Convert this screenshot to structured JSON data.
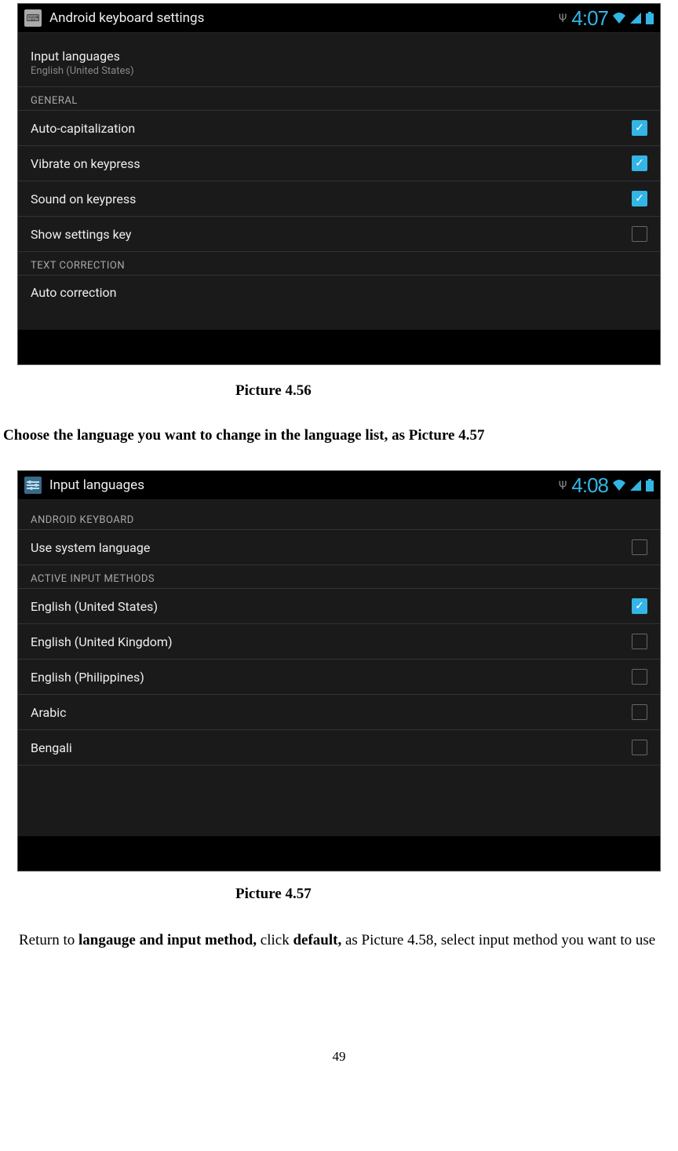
{
  "shot1": {
    "statusbar": {
      "title": "Android keyboard settings",
      "clock": "4:07"
    },
    "items": {
      "input_languages": "Input languages",
      "input_languages_sub": "English (United States)"
    },
    "sections": {
      "general": "GENERAL",
      "text_correction": "TEXT CORRECTION"
    },
    "rows": [
      {
        "label": "Auto-capitalization",
        "checked": true
      },
      {
        "label": "Vibrate on keypress",
        "checked": true
      },
      {
        "label": "Sound on keypress",
        "checked": true
      },
      {
        "label": "Show settings key",
        "checked": false
      }
    ],
    "last_row": "Auto correction"
  },
  "caption1": "Picture 4.56",
  "midtext": "Choose the language you want to change in the language list, as Picture 4.57",
  "shot2": {
    "statusbar": {
      "title": "Input languages",
      "clock": "4:08"
    },
    "sections": {
      "android_keyboard": "ANDROID KEYBOARD",
      "active_input": "ACTIVE INPUT METHODS"
    },
    "rows": [
      {
        "label": "Use system language",
        "checked": false,
        "section_after": true
      },
      {
        "label": "English (United States)",
        "checked": true
      },
      {
        "label": "English (United Kingdom)",
        "checked": false
      },
      {
        "label": "English (Philippines)",
        "checked": false
      },
      {
        "label": "Arabic",
        "checked": false
      },
      {
        "label": "Bengali",
        "checked": false
      }
    ]
  },
  "caption2": "Picture 4.57",
  "bottom_text_prefix": "Return to ",
  "bottom_text_bold1": "langauge and input method, ",
  "bottom_text_mid1": "click ",
  "bottom_text_bold2": "default, ",
  "bottom_text_rest": "as Picture 4.58, select input method you want to use",
  "page_number": "49"
}
